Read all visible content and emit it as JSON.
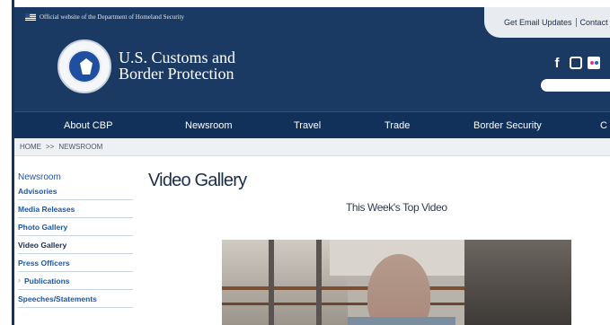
{
  "gov_banner": {
    "text": "Official website of the Department of Homeland Security"
  },
  "utility": {
    "items": [
      "Get Email Updates",
      "Contact Us",
      "Co"
    ]
  },
  "brand": {
    "line1": "U.S. Customs and",
    "line2": "Border Protection"
  },
  "social": {
    "facebook": "f",
    "instagram": "IG",
    "flickr": ""
  },
  "nav": {
    "items": [
      "About CBP",
      "Newsroom",
      "Travel",
      "Trade",
      "Border Security",
      "C"
    ]
  },
  "breadcrumb": {
    "home": "HOME",
    "sep": ">>",
    "current": "NEWSROOM"
  },
  "sidebar": {
    "heading": "Newsroom",
    "items": [
      "Advisories",
      "Media Releases",
      "Photo Gallery",
      "Video Gallery",
      "Press Officers",
      "Publications",
      "Speeches/Statements"
    ]
  },
  "main": {
    "title": "Video Gallery",
    "video_heading": "This Week's Top Video"
  },
  "colors": {
    "header": "#1b3a63",
    "nav": "#12315a",
    "link": "#1a56a5",
    "accent_text": "#1b2d4a"
  }
}
